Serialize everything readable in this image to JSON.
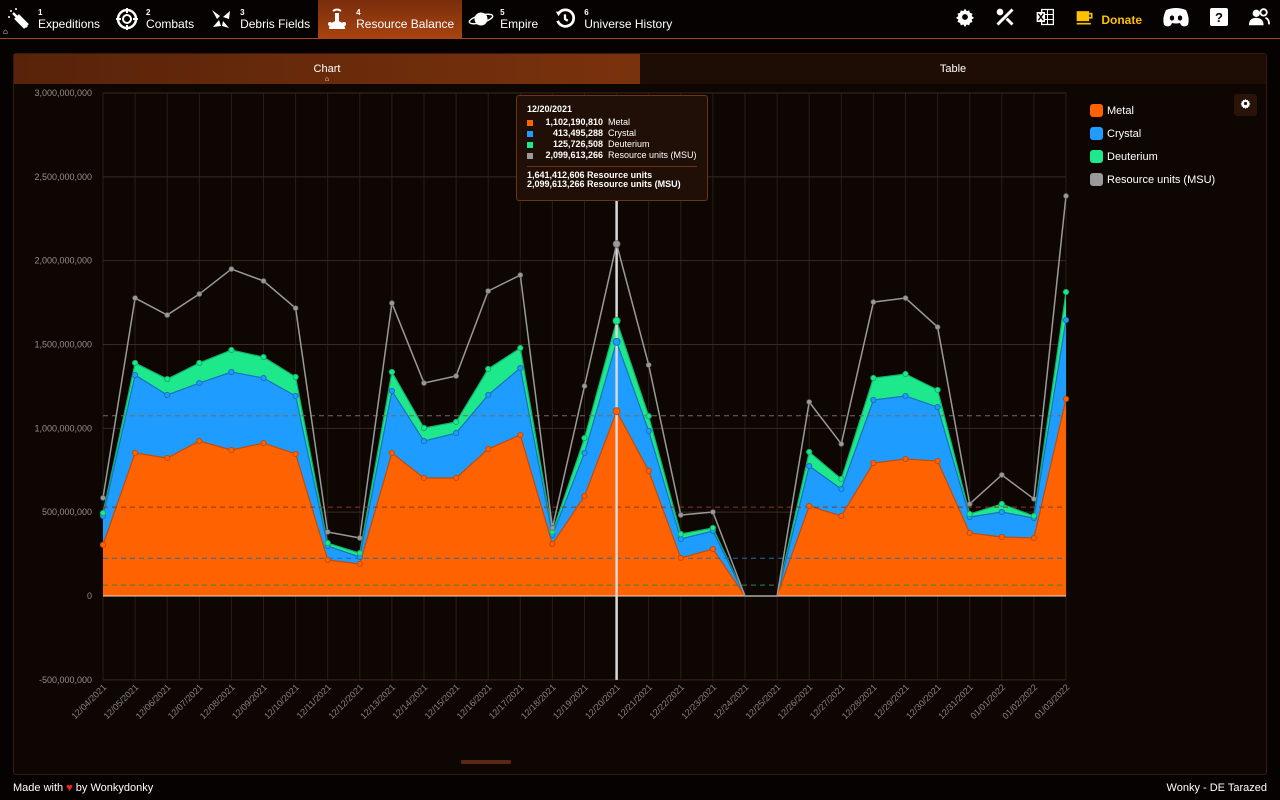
{
  "nav": {
    "items": [
      {
        "num": "1",
        "label": "Expeditions",
        "icon": "comet-icon"
      },
      {
        "num": "2",
        "label": "Combats",
        "icon": "crosshair-icon"
      },
      {
        "num": "3",
        "label": "Debris Fields",
        "icon": "debris-icon"
      },
      {
        "num": "4",
        "label": "Resource Balance",
        "icon": "resource-balance-icon",
        "active": true
      },
      {
        "num": "5",
        "label": "Empire",
        "icon": "planet-icon"
      },
      {
        "num": "6",
        "label": "Universe History",
        "icon": "history-icon"
      }
    ],
    "home_glyph": "⌂",
    "donate_label": "Donate"
  },
  "tabs": [
    {
      "label": "Chart",
      "active": true
    },
    {
      "label": "Table",
      "active": false
    }
  ],
  "colors": {
    "metal": "#ff6200",
    "crystal": "#1e9cff",
    "deuterium": "#1de98c",
    "msu": "#9a9a9a",
    "accent": "#a84411",
    "donate": "#ffc000"
  },
  "legend": [
    {
      "label": "Metal",
      "color": "#ff6200"
    },
    {
      "label": "Crystal",
      "color": "#1e9cff"
    },
    {
      "label": "Deuterium",
      "color": "#1de98c"
    },
    {
      "label": "Resource units (MSU)",
      "color": "#9a9a9a"
    }
  ],
  "tooltip": {
    "date": "12/20/2021",
    "rows": [
      {
        "value": "1,102,190,810",
        "label": "Metal",
        "color": "#ff6200"
      },
      {
        "value": "413,495,288",
        "label": "Crystal",
        "color": "#1e9cff"
      },
      {
        "value": "125,726,508",
        "label": "Deuterium",
        "color": "#1de98c"
      },
      {
        "value": "2,099,613,266",
        "label": "Resource units (MSU)",
        "color": "#9a9a9a"
      }
    ],
    "total_ru": "1,641,412,606 Resource units",
    "total_msu": "2,099,613,266 Resource units (MSU)"
  },
  "chart_data": {
    "type": "area",
    "stacked": true,
    "title": "",
    "xlabel": "",
    "ylabel": "",
    "ylim": [
      -500000000,
      3000000000
    ],
    "yticks": [
      "3,000,000,000",
      "2,500,000,000",
      "2,000,000,000",
      "1,500,000,000",
      "1,000,000,000",
      "500,000,000",
      "0",
      "-500,000,000"
    ],
    "ytick_values": [
      3000000000,
      2500000000,
      2000000000,
      1500000000,
      1000000000,
      500000000,
      0,
      -500000000
    ],
    "categories": [
      "12/04/2021",
      "12/05/2021",
      "12/06/2021",
      "12/07/2021",
      "12/08/2021",
      "12/09/2021",
      "12/10/2021",
      "12/11/2021",
      "12/12/2021",
      "12/13/2021",
      "12/14/2021",
      "12/15/2021",
      "12/16/2021",
      "12/17/2021",
      "12/18/2021",
      "12/19/2021",
      "12/20/2021",
      "12/21/2021",
      "12/22/2021",
      "12/23/2021",
      "12/24/2021",
      "12/25/2021",
      "12/26/2021",
      "12/27/2021",
      "12/28/2021",
      "12/29/2021",
      "12/30/2021",
      "12/31/2021",
      "01/01/2022",
      "01/02/2022",
      "01/03/2022"
    ],
    "clipped_next_label": "01/",
    "series": [
      {
        "name": "Metal",
        "stack": true,
        "values": [
          305000000,
          853000000,
          823000000,
          924000000,
          871000000,
          912000000,
          847000000,
          215000000,
          191000000,
          853000000,
          704000000,
          704000000,
          877000000,
          960000000,
          310000000,
          596000000,
          1102190810,
          746000000,
          227000000,
          280000000,
          0,
          0,
          537000000,
          477000000,
          793000000,
          817000000,
          805000000,
          376000000,
          352000000,
          346000000,
          1175000000
        ]
      },
      {
        "name": "Crystal",
        "stack": true,
        "values": [
          172000000,
          465000000,
          376000000,
          346000000,
          465000000,
          388000000,
          346000000,
          83000000,
          42000000,
          370000000,
          220000000,
          268000000,
          322000000,
          400000000,
          54000000,
          257000000,
          413495288,
          238000000,
          113000000,
          108000000,
          0,
          0,
          238000000,
          161000000,
          376000000,
          376000000,
          322000000,
          95000000,
          149000000,
          119000000,
          471000000
        ]
      },
      {
        "name": "Deuterium",
        "stack": true,
        "values": [
          18000000,
          72000000,
          95000000,
          120000000,
          131000000,
          125000000,
          113000000,
          18000000,
          23000000,
          113000000,
          78000000,
          66000000,
          155000000,
          119000000,
          18000000,
          89000000,
          125726508,
          89000000,
          30000000,
          18000000,
          0,
          0,
          84000000,
          60000000,
          131000000,
          131000000,
          102000000,
          18000000,
          48000000,
          12000000,
          167000000
        ]
      },
      {
        "name": "Resource units (MSU)",
        "stack": false,
        "values": [
          585000000,
          1777000000,
          1676000000,
          1801000000,
          1950000000,
          1879000000,
          1717000000,
          382000000,
          346000000,
          1747000000,
          1270000000,
          1312000000,
          1819000000,
          1914000000,
          406000000,
          1252000000,
          2099613266,
          1378000000,
          483000000,
          501000000,
          0,
          0,
          1157000000,
          907000000,
          1753000000,
          1777000000,
          1604000000,
          549000000,
          722000000,
          579000000,
          2386000000
        ]
      }
    ],
    "reference_lines": [
      {
        "name": "avg-msu",
        "value": 1075000000,
        "color": "#7a6a60"
      },
      {
        "name": "avg-metal",
        "value": 530000000,
        "color": "#8a3a10"
      },
      {
        "name": "avg-crystal",
        "value": 225000000,
        "color": "#1e6ea8"
      },
      {
        "name": "avg-deuterium",
        "value": 65000000,
        "color": "#2a8a40"
      }
    ],
    "highlighted_category": "12/20/2021",
    "grid": true,
    "legend_position": "right"
  },
  "footer": {
    "made_with": "Made with",
    "heart": "♥",
    "by": "by Wonkydonky",
    "right": "Wonky - DE Tarazed"
  }
}
